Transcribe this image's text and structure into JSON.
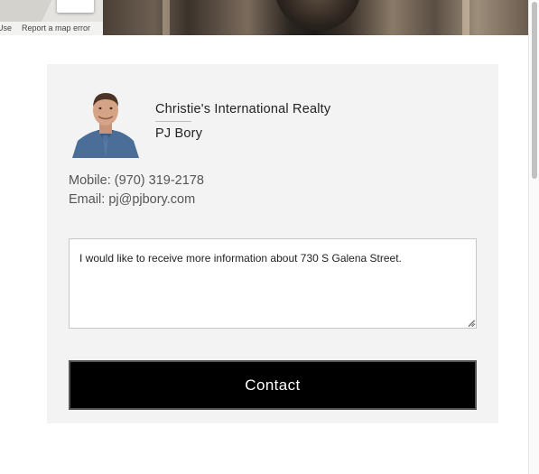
{
  "map": {
    "terms_link": "Use",
    "report_link": "Report a map error"
  },
  "agent": {
    "company": "Christie's International Realty",
    "name": "PJ Bory",
    "mobile": "Mobile: (970) 319-2178",
    "email": "Email: pj@pjbory.com"
  },
  "form": {
    "message_value": "I would like to receive more information about 730 S Galena Street.",
    "contact_label": "Contact"
  },
  "colors": {
    "card_background": "#f3f3f3",
    "button_background": "#000000",
    "button_text": "#ffffff"
  }
}
